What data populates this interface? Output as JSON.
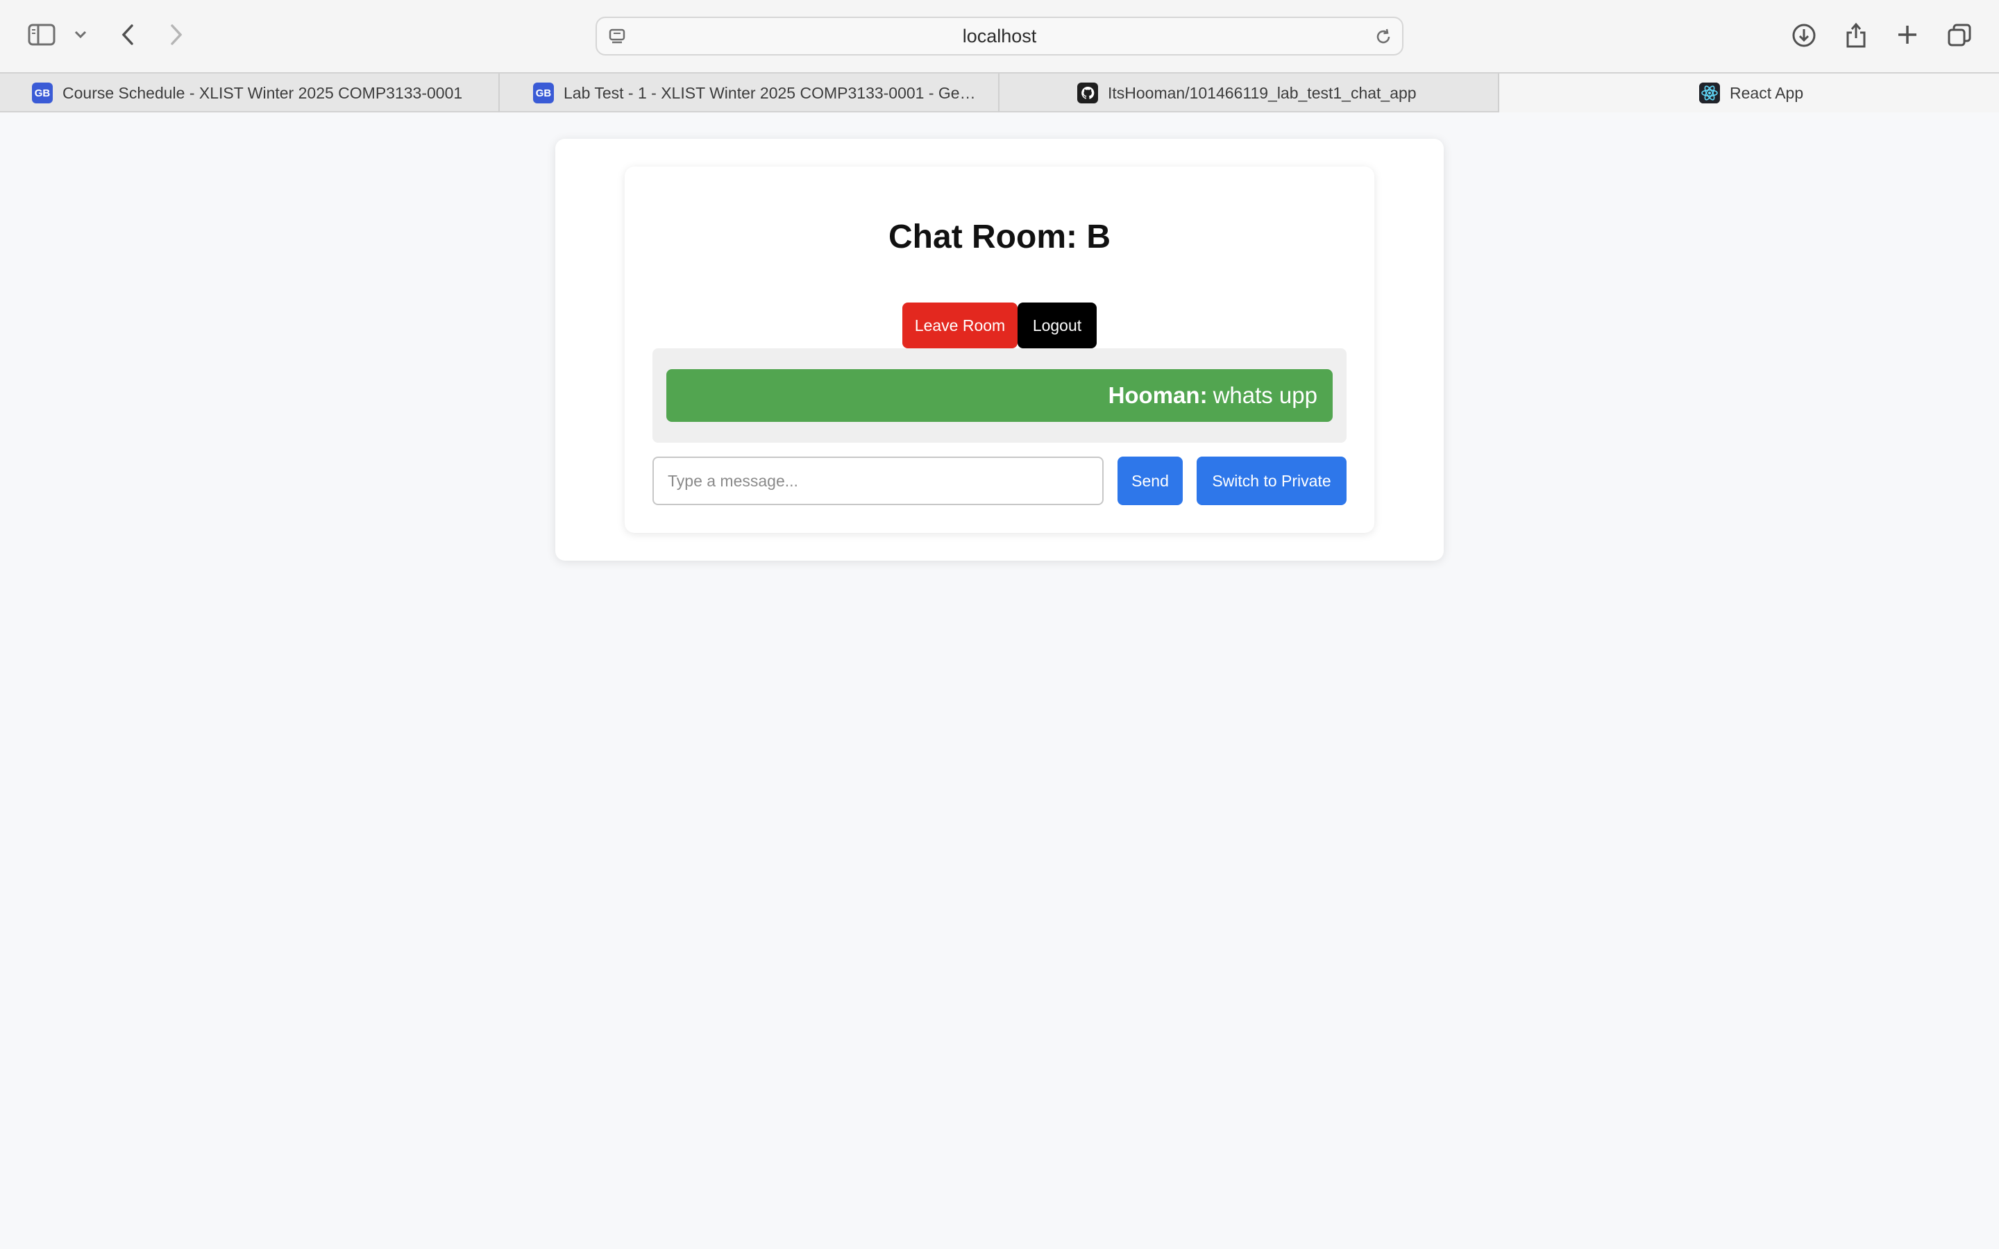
{
  "browser": {
    "url": "localhost",
    "tabs": [
      {
        "label": "Course Schedule - XLIST Winter 2025 COMP3133-0001",
        "icon": "gbc-favicon-icon"
      },
      {
        "label": "Lab Test - 1 - XLIST Winter 2025 COMP3133-0001 - Geor...",
        "icon": "gbc-favicon-icon"
      },
      {
        "label": "ItsHooman/101466119_lab_test1_chat_app",
        "icon": "github-icon"
      },
      {
        "label": "React App",
        "icon": "react-icon",
        "active": true
      }
    ]
  },
  "chat": {
    "title": "Chat Room: B",
    "leave_label": "Leave Room",
    "logout_label": "Logout",
    "messages": [
      {
        "sender": "Hooman:",
        "text": "whats upp"
      }
    ],
    "input": {
      "value": "",
      "placeholder": "Type a message..."
    },
    "send_label": "Send",
    "switch_label": "Switch to Private"
  },
  "colors": {
    "leave": "#e3281f",
    "logout": "#000000",
    "message_bg": "#52a550",
    "primary": "#2e77ea"
  }
}
